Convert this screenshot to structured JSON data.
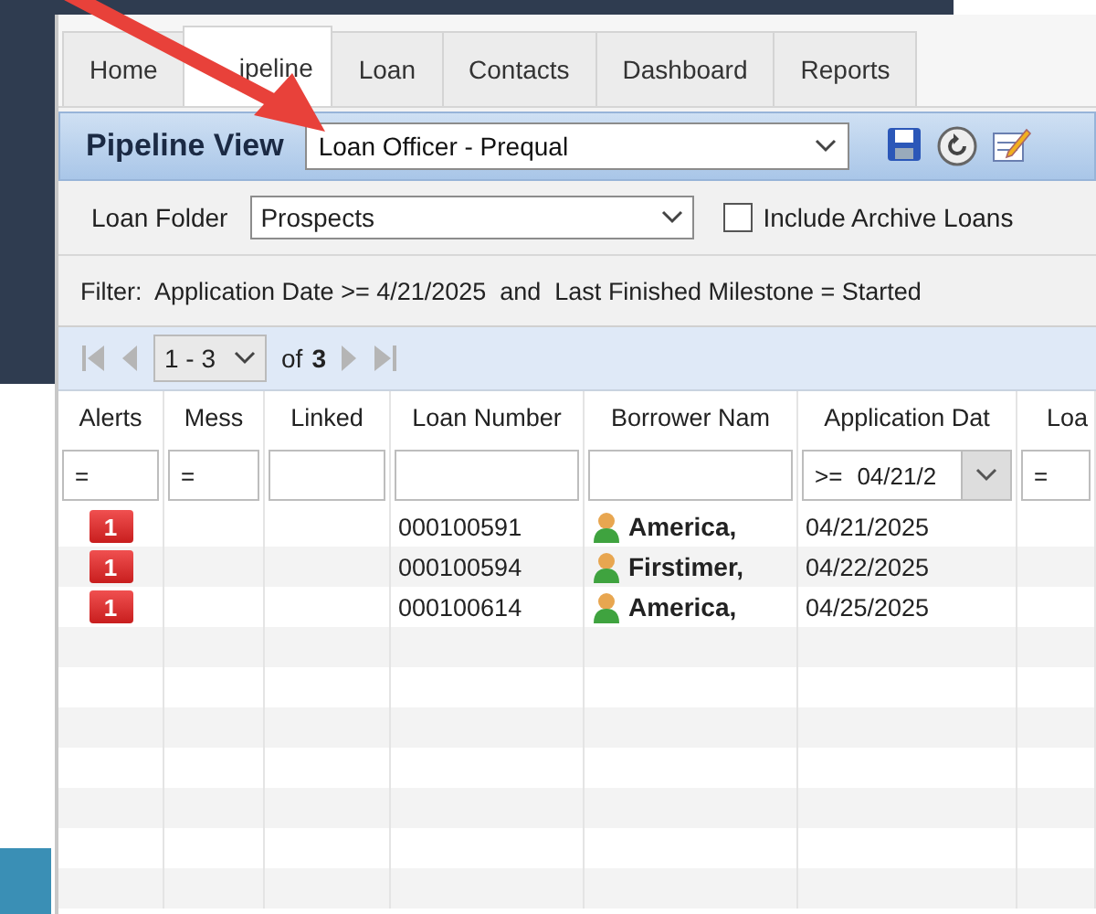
{
  "tabs": [
    {
      "label": "Home",
      "selected": false
    },
    {
      "label": "ipeline",
      "selected": true
    },
    {
      "label": "Loan",
      "selected": false
    },
    {
      "label": "Contacts",
      "selected": false
    },
    {
      "label": "Dashboard",
      "selected": false
    },
    {
      "label": "Reports",
      "selected": false
    }
  ],
  "view_bar": {
    "title": "Pipeline View",
    "view": "Loan Officer - Prequal"
  },
  "folder_bar": {
    "label": "Loan Folder",
    "folder": "Prospects",
    "archive": {
      "label": "Include Archive Loans",
      "checked": false
    }
  },
  "filter": "Filter:  Application Date >= 4/21/2025  and  Last Finished Milestone = Started",
  "pager": {
    "range": "1 - 3",
    "of": "of",
    "total": "3"
  },
  "table": {
    "columns": [
      {
        "label": "Alerts",
        "filter": "="
      },
      {
        "label": "Mess",
        "filter": "="
      },
      {
        "label": "Linked"
      },
      {
        "label": "Loan Number"
      },
      {
        "label": "Borrower Nam"
      },
      {
        "label": "Application Dat",
        "operator": ">=",
        "filter": "04/21/2",
        "kind": "dropdown"
      },
      {
        "label": "Loa",
        "filter": "="
      }
    ],
    "rows": [
      {
        "alerts": "1",
        "loan_number": "000100591",
        "borrower": "America,",
        "application_date": "04/21/2025"
      },
      {
        "alerts": "1",
        "loan_number": "000100594",
        "borrower": "Firstimer,",
        "application_date": "04/22/2025"
      },
      {
        "alerts": "1",
        "loan_number": "000100614",
        "borrower": "America,",
        "application_date": "04/25/2025"
      }
    ]
  }
}
